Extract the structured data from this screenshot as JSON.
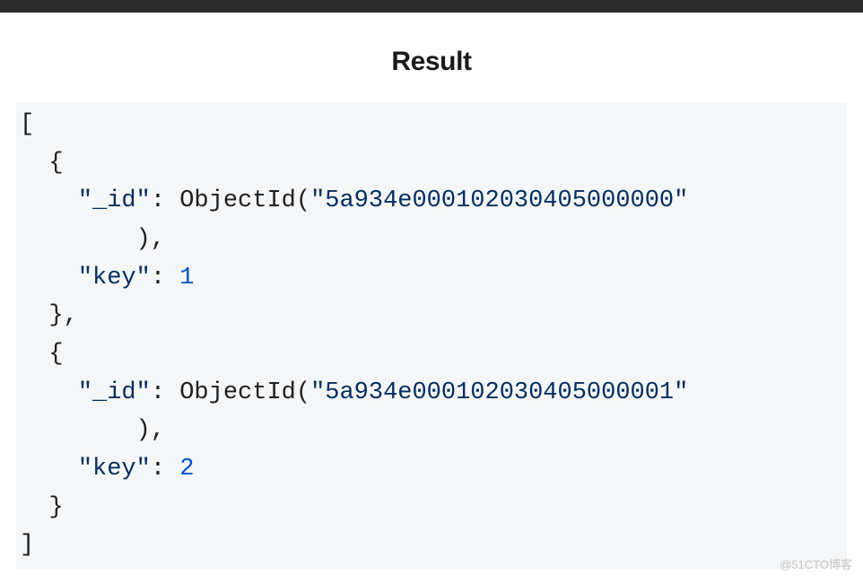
{
  "top_bar": {},
  "heading": "Result",
  "code": {
    "punct": {
      "lbracket": "[",
      "rbracket": "]",
      "lbrace": "{",
      "rbrace": "}",
      "rbrace_comma": "},",
      "colon_sp": ": ",
      "paren_open": "(",
      "paren_close": ")",
      "paren_close_comma": "),",
      "comma": ","
    },
    "indent": {
      "i1": "  ",
      "i2": "    ",
      "i3": "        "
    },
    "func": "ObjectId",
    "records": [
      {
        "id_key": "\"_id\"",
        "id_val": "\"5a934e000102030405000000\"",
        "key_key": "\"key\"",
        "key_val": "1"
      },
      {
        "id_key": "\"_id\"",
        "id_val": "\"5a934e000102030405000001\"",
        "key_key": "\"key\"",
        "key_val": "2"
      }
    ]
  },
  "watermark": "@51CTO博客"
}
